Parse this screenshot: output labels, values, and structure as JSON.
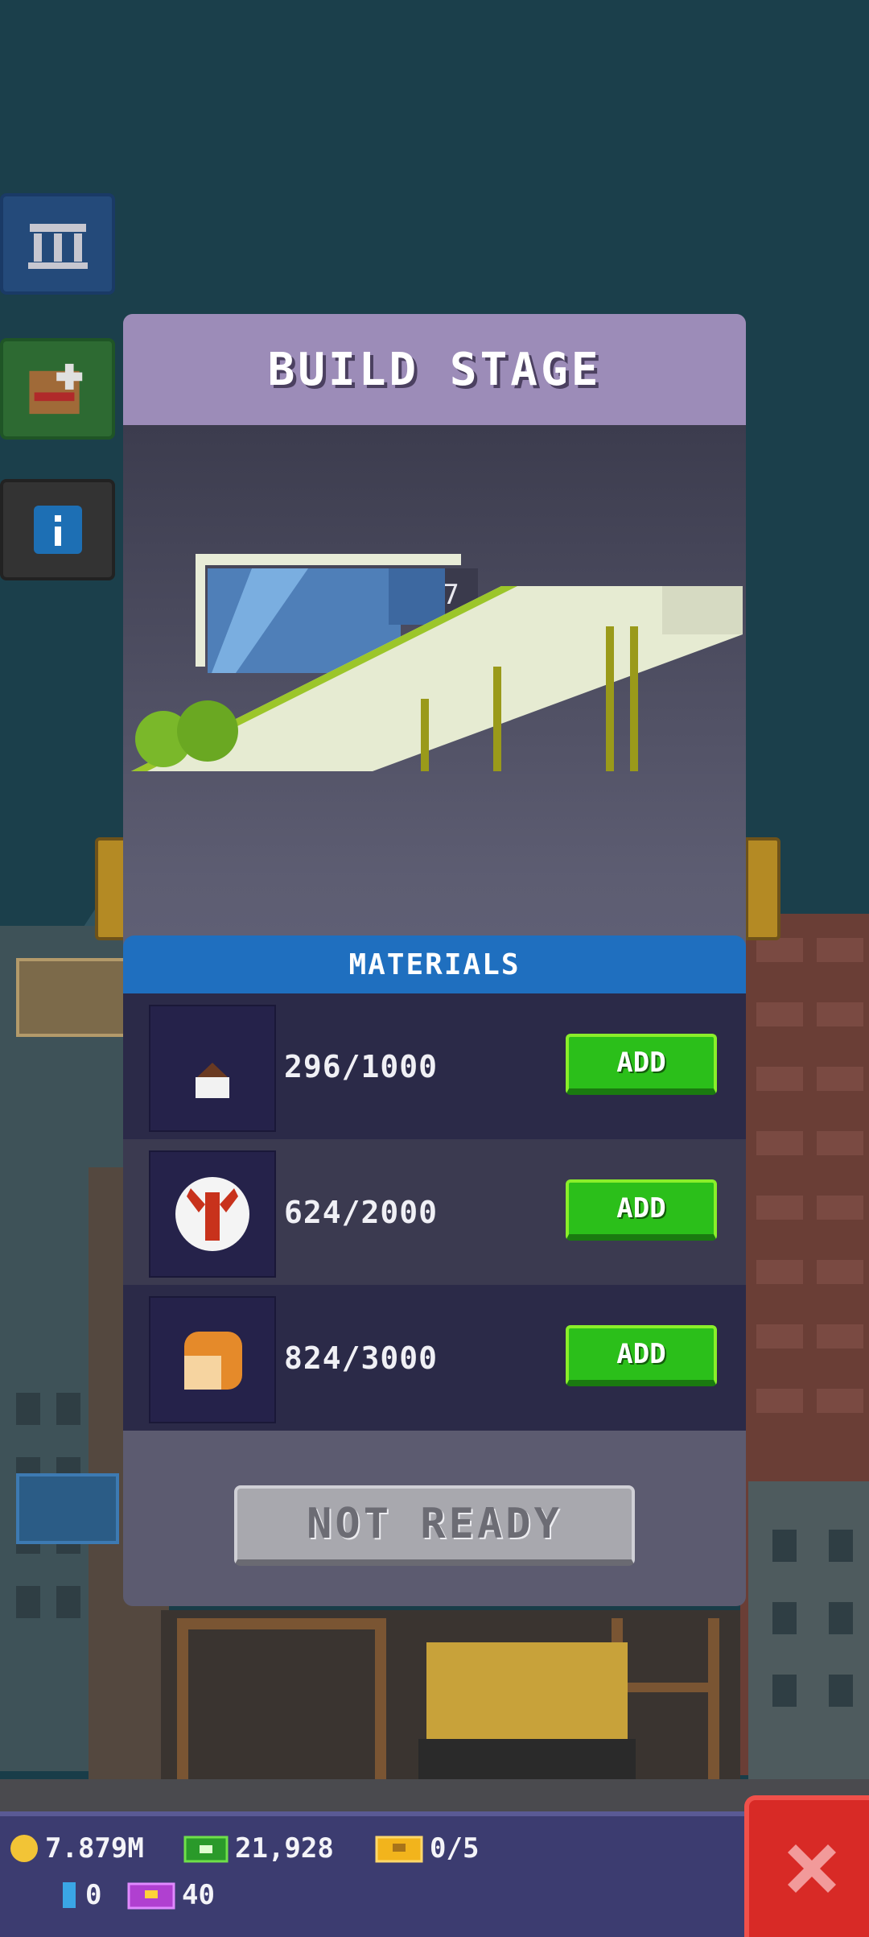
{
  "modal": {
    "title": "BUILD STAGE",
    "stage_counter": "1/7",
    "materials_header": "MATERIALS",
    "materials": [
      {
        "icon": "cupcake-icon",
        "count": "296/1000",
        "add_label": "ADD"
      },
      {
        "icon": "lobster-plate-icon",
        "count": "624/2000",
        "add_label": "ADD"
      },
      {
        "icon": "bread-loaf-icon",
        "count": "824/3000",
        "add_label": "ADD"
      }
    ],
    "not_ready_label": "NOT READY"
  },
  "hud": {
    "coins": "7.879M",
    "bux": "21,928",
    "tickets": "0/5",
    "blue_item": "0",
    "gems": "40"
  },
  "colors": {
    "header_purple": "#9c8cb8",
    "materials_blue": "#1f6fbf",
    "add_green": "#2bbf1a",
    "close_red": "#d82a26"
  }
}
